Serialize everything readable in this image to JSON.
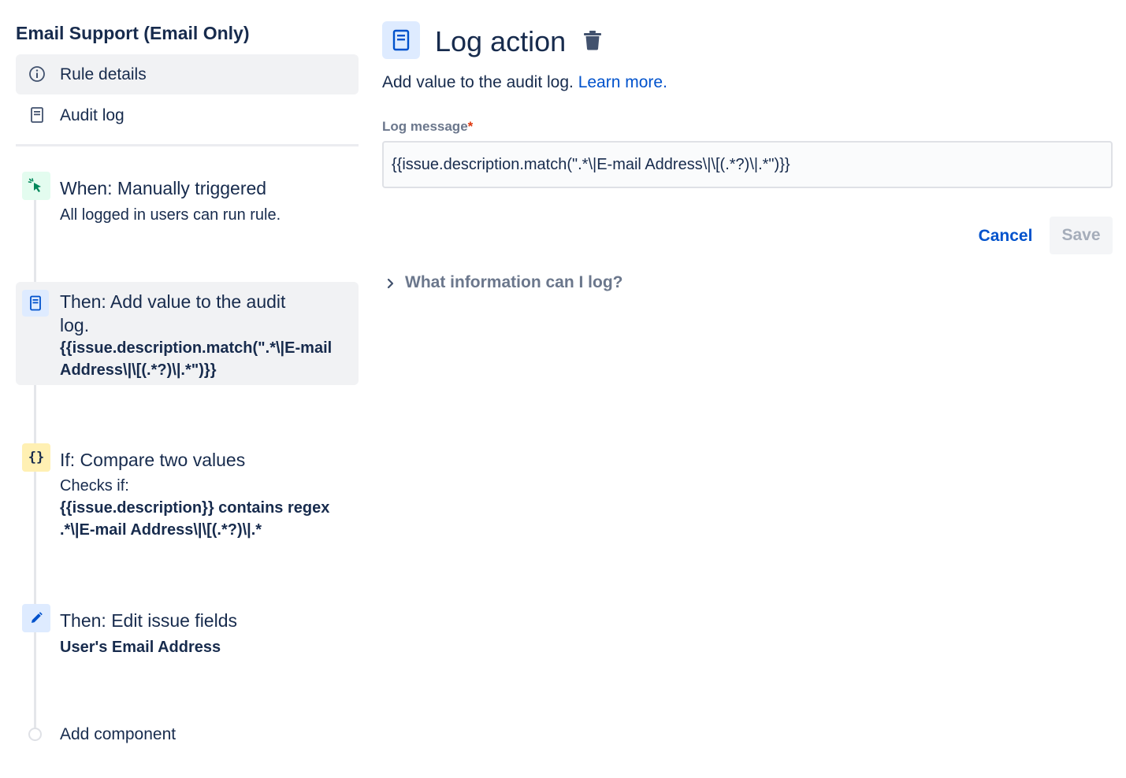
{
  "sidebar": {
    "rule_title": "Email Support (Email Only)",
    "nav": [
      {
        "label": "Rule details",
        "icon": "info-icon",
        "active": true
      },
      {
        "label": "Audit log",
        "icon": "document-icon",
        "active": false
      }
    ],
    "components": [
      {
        "title": "When: Manually triggered",
        "subtitle": "All logged in users can run rule.",
        "icon": "cursor-click-icon",
        "color": "#e3fcef",
        "icon_color": "#00875a"
      },
      {
        "title": "Then: Add value to the audit log.",
        "detail": "{{issue.description.match(\".*\\|E-mail Address\\|\\[(.*?)\\|.*\")}}",
        "icon": "document-icon",
        "color": "#deebff",
        "icon_color": "#0052cc"
      },
      {
        "title": "If: Compare two values",
        "subtitle": "Checks if:",
        "detail": "{{issue.description}} contains regex .*\\|E-mail Address\\|\\[(.*?)\\|.*",
        "icon": "braces-icon",
        "color": "#fff0b3",
        "icon_color": "#172b4d"
      },
      {
        "title": "Then: Edit issue fields",
        "detail": "User's Email Address",
        "icon": "pencil-icon",
        "color": "#deebff",
        "icon_color": "#0052cc"
      }
    ],
    "add_component": "Add component"
  },
  "main": {
    "title": "Log action",
    "description": "Add value to the audit log.",
    "learn_more": "Learn more.",
    "field_label": "Log message",
    "required_mark": "*",
    "field_value": "{{issue.description.match(\".*\\|E-mail Address\\|\\[(.*?)\\|.*\")}}",
    "cancel_label": "Cancel",
    "save_label": "Save",
    "expander_label": "What information can I log?"
  },
  "colors": {
    "text": "#172b4d",
    "link": "#0052cc",
    "muted": "#6b778c",
    "active_bg": "#f1f2f4"
  }
}
